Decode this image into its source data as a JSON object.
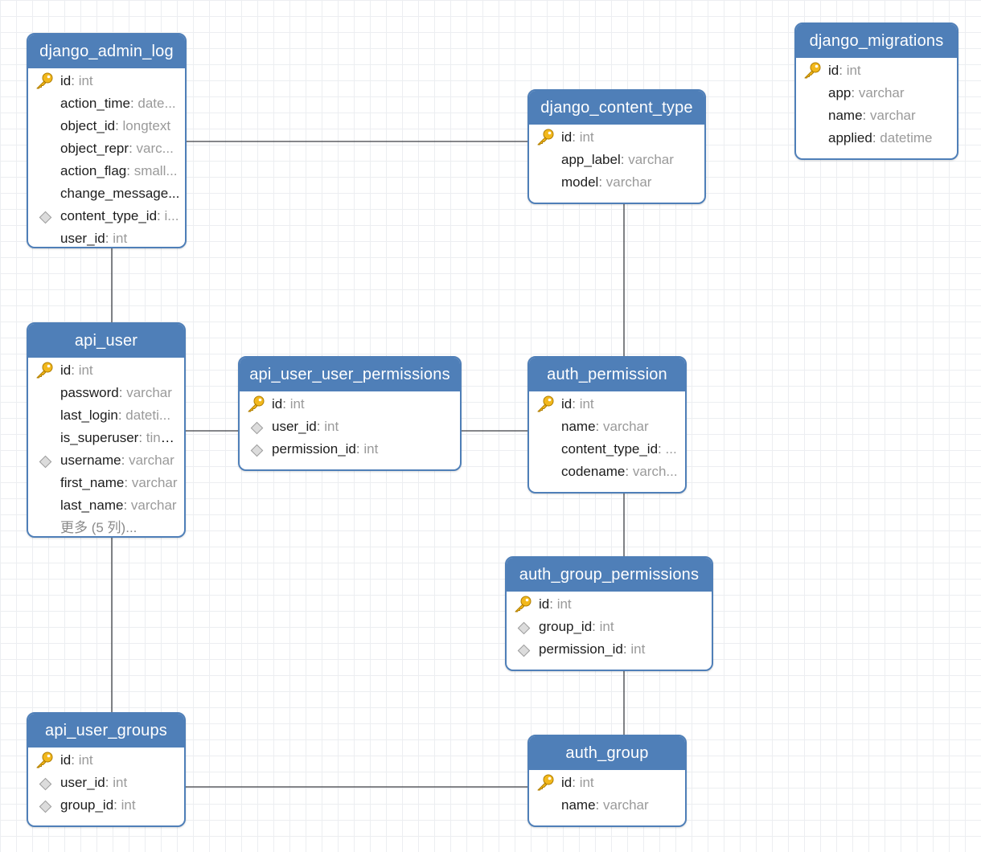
{
  "tables": [
    {
      "id": "django_admin_log",
      "title": "django_admin_log",
      "fields": [
        {
          "name": "id",
          "type": "int",
          "key": "pk"
        },
        {
          "name": "action_time",
          "type": "date...",
          "key": ""
        },
        {
          "name": "object_id",
          "type": "longtext",
          "key": ""
        },
        {
          "name": "object_repr",
          "type": "varc...",
          "key": ""
        },
        {
          "name": "action_flag",
          "type": "small...",
          "key": ""
        },
        {
          "name": "change_message...",
          "type": "",
          "key": ""
        },
        {
          "name": "content_type_id",
          "type": "i...",
          "key": "fk"
        },
        {
          "name": "user_id",
          "type": "int",
          "key": ""
        }
      ]
    },
    {
      "id": "django_content_type",
      "title": "django_content_type",
      "fields": [
        {
          "name": "id",
          "type": "int",
          "key": "pk"
        },
        {
          "name": "app_label",
          "type": "varchar",
          "key": ""
        },
        {
          "name": "model",
          "type": "varchar",
          "key": ""
        }
      ]
    },
    {
      "id": "django_migrations",
      "title": "django_migrations",
      "fields": [
        {
          "name": "id",
          "type": "int",
          "key": "pk"
        },
        {
          "name": "app",
          "type": "varchar",
          "key": ""
        },
        {
          "name": "name",
          "type": "varchar",
          "key": ""
        },
        {
          "name": "applied",
          "type": "datetime",
          "key": ""
        }
      ]
    },
    {
      "id": "api_user",
      "title": "api_user",
      "fields": [
        {
          "name": "id",
          "type": "int",
          "key": "pk"
        },
        {
          "name": "password",
          "type": "varchar",
          "key": ""
        },
        {
          "name": "last_login",
          "type": "dateti...",
          "key": ""
        },
        {
          "name": "is_superuser",
          "type": "tinyi...",
          "key": ""
        },
        {
          "name": "username",
          "type": "varchar",
          "key": "fk"
        },
        {
          "name": "first_name",
          "type": "varchar",
          "key": ""
        },
        {
          "name": "last_name",
          "type": "varchar",
          "key": ""
        }
      ],
      "more": "更多 (5 列)..."
    },
    {
      "id": "api_user_user_permissions",
      "title": "api_user_user_permissions",
      "fields": [
        {
          "name": "id",
          "type": "int",
          "key": "pk"
        },
        {
          "name": "user_id",
          "type": "int",
          "key": "fk"
        },
        {
          "name": "permission_id",
          "type": "int",
          "key": "fk"
        }
      ]
    },
    {
      "id": "auth_permission",
      "title": "auth_permission",
      "fields": [
        {
          "name": "id",
          "type": "int",
          "key": "pk"
        },
        {
          "name": "name",
          "type": "varchar",
          "key": ""
        },
        {
          "name": "content_type_id",
          "type": "...",
          "key": ""
        },
        {
          "name": "codename",
          "type": "varch...",
          "key": ""
        }
      ]
    },
    {
      "id": "auth_group_permissions",
      "title": "auth_group_permissions",
      "fields": [
        {
          "name": "id",
          "type": "int",
          "key": "pk"
        },
        {
          "name": "group_id",
          "type": "int",
          "key": "fk"
        },
        {
          "name": "permission_id",
          "type": "int",
          "key": "fk"
        }
      ]
    },
    {
      "id": "api_user_groups",
      "title": "api_user_groups",
      "fields": [
        {
          "name": "id",
          "type": "int",
          "key": "pk"
        },
        {
          "name": "user_id",
          "type": "int",
          "key": "fk"
        },
        {
          "name": "group_id",
          "type": "int",
          "key": "fk"
        }
      ]
    },
    {
      "id": "auth_group",
      "title": "auth_group",
      "fields": [
        {
          "name": "id",
          "type": "int",
          "key": "pk"
        },
        {
          "name": "name",
          "type": "varchar",
          "key": ""
        }
      ]
    }
  ],
  "relations": [
    {
      "from": "django_admin_log",
      "to": "django_content_type"
    },
    {
      "from": "django_admin_log",
      "to": "api_user"
    },
    {
      "from": "django_content_type",
      "to": "auth_permission"
    },
    {
      "from": "api_user",
      "to": "api_user_user_permissions"
    },
    {
      "from": "api_user_user_permissions",
      "to": "auth_permission"
    },
    {
      "from": "auth_permission",
      "to": "auth_group_permissions"
    },
    {
      "from": "auth_group_permissions",
      "to": "auth_group"
    },
    {
      "from": "api_user",
      "to": "api_user_groups"
    },
    {
      "from": "api_user_groups",
      "to": "auth_group"
    }
  ],
  "colors": {
    "header": "#4f7fb8",
    "border": "#4f7fb8",
    "key": "#f2b81c"
  }
}
